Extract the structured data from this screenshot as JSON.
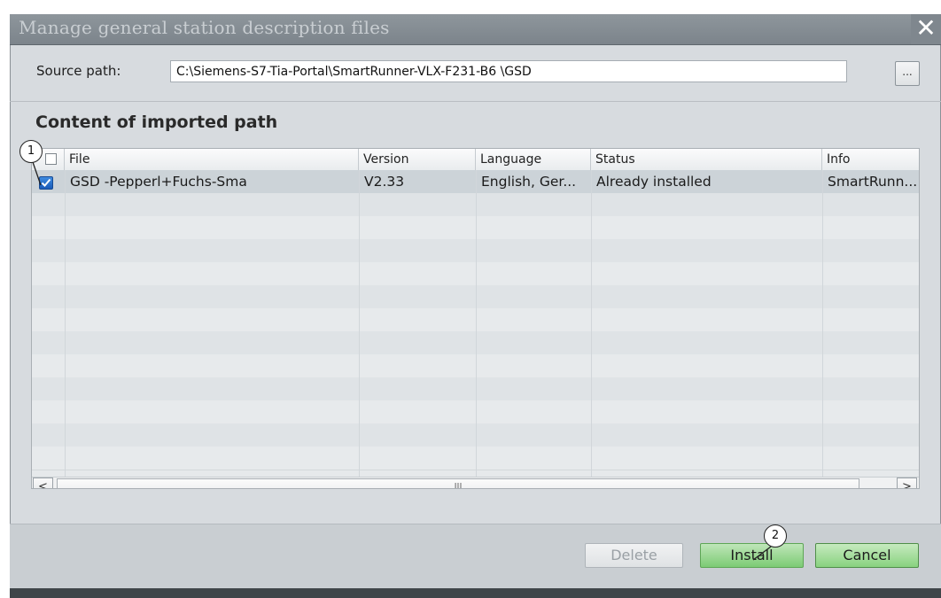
{
  "dialog": {
    "title": "Manage general station description files",
    "close_glyph": "✕"
  },
  "source": {
    "label": "Source path:",
    "value": "C:\\Siemens-S7-Tia-Portal\\SmartRunner-VLX-F231-B6  \\GSD",
    "browse_label": "..."
  },
  "content": {
    "title": "Content of imported path",
    "columns": [
      "File",
      "Version",
      "Language",
      "Status",
      "Info"
    ],
    "rows": [
      {
        "checked": true,
        "file": "GSD              -Pepperl+Fuchs-Sma",
        "version": "V2.33",
        "language": "English, Ger...",
        "status": "Already installed",
        "info": "SmartRunn..."
      }
    ]
  },
  "scrollbar": {
    "left_arrow": "<",
    "right_arrow": ">",
    "thumb_grip": "III"
  },
  "buttons": {
    "delete": "Delete",
    "install": "Install",
    "cancel": "Cancel"
  },
  "callouts": [
    "1",
    "2"
  ],
  "icons": [
    "close-icon",
    "checkbox-checked-icon",
    "browse-icon",
    "scroll-left-icon",
    "scroll-right-icon"
  ]
}
